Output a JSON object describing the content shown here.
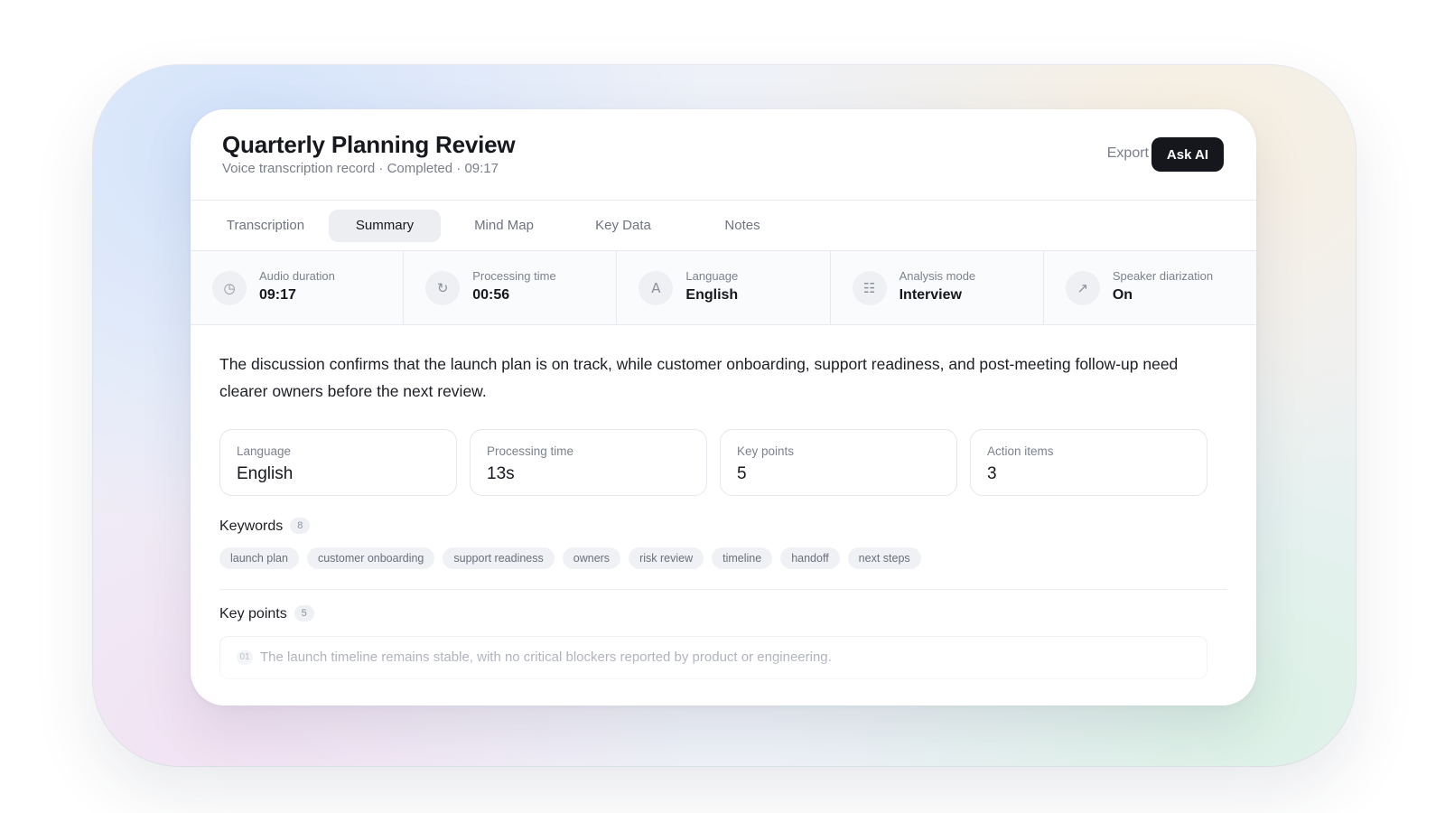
{
  "header": {
    "title": "Quarterly Planning Review",
    "subtitle": "Voice transcription record · Completed · 09:17",
    "export_label": "Export",
    "ask_label": "Ask AI"
  },
  "tabs": [
    {
      "label": "Transcription",
      "active": false
    },
    {
      "label": "Summary",
      "active": true
    },
    {
      "label": "Mind Map",
      "active": false
    },
    {
      "label": "Key Data",
      "active": false
    },
    {
      "label": "Notes",
      "active": false
    }
  ],
  "stats": [
    {
      "icon": "clock-icon",
      "glyph": "◷",
      "label": "Audio duration",
      "value": "09:17"
    },
    {
      "icon": "refresh-icon",
      "glyph": "↻",
      "label": "Processing time",
      "value": "00:56"
    },
    {
      "icon": "language-icon",
      "glyph": "A",
      "label": "Language",
      "value": "English"
    },
    {
      "icon": "list-icon",
      "glyph": "☷",
      "label": "Analysis mode",
      "value": "Interview"
    },
    {
      "icon": "arrow-icon",
      "glyph": "↗",
      "label": "Speaker diarization",
      "value": "On"
    }
  ],
  "summary": "The discussion confirms that the launch plan is on track, while customer onboarding, support readiness, and post-meeting follow-up need clearer owners before the next review.",
  "metrics": [
    {
      "label": "Language",
      "value": "English"
    },
    {
      "label": "Processing time",
      "value": "13s"
    },
    {
      "label": "Key points",
      "value": "5"
    },
    {
      "label": "Action items",
      "value": "3"
    }
  ],
  "keywords": {
    "title": "Keywords",
    "count": "8",
    "items": [
      "launch plan",
      "customer onboarding",
      "support readiness",
      "owners",
      "risk review",
      "timeline",
      "handoff",
      "next steps"
    ]
  },
  "key_points": {
    "title": "Key points",
    "count": "5",
    "items": [
      {
        "num": "01",
        "text": "The launch timeline remains stable, with no critical blockers reported by product or engineering."
      }
    ]
  },
  "colors": {
    "accent": "#15171c",
    "active_tab_bg": "#eceef2",
    "chip_bg": "#eff1f4"
  }
}
